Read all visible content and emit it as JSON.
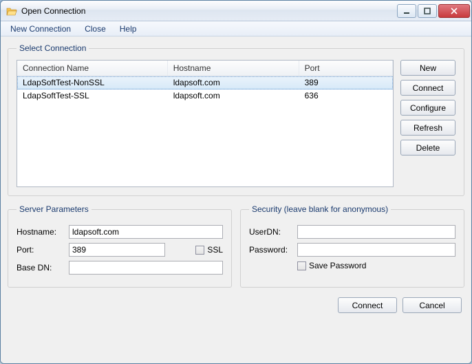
{
  "window": {
    "title": "Open Connection"
  },
  "menu": {
    "new_connection": "New Connection",
    "close": "Close",
    "help": "Help"
  },
  "select": {
    "legend": "Select Connection",
    "columns": {
      "name": "Connection Name",
      "host": "Hostname",
      "port": "Port"
    },
    "rows": [
      {
        "name": "LdapSoftTest-NonSSL",
        "host": "ldapsoft.com",
        "port": "389",
        "selected": true
      },
      {
        "name": "LdapSoftTest-SSL",
        "host": "ldapsoft.com",
        "port": "636",
        "selected": false
      }
    ],
    "buttons": {
      "new": "New",
      "connect": "Connect",
      "configure": "Configure",
      "refresh": "Refresh",
      "delete": "Delete"
    }
  },
  "server": {
    "legend": "Server Parameters",
    "labels": {
      "hostname": "Hostname:",
      "port": "Port:",
      "basedn": "Base DN:",
      "ssl": "SSL"
    },
    "values": {
      "hostname": "ldapsoft.com",
      "port": "389",
      "basedn": ""
    },
    "ssl_checked": false
  },
  "security": {
    "legend": "Security (leave blank for anonymous)",
    "labels": {
      "userdn": "UserDN:",
      "password": "Password:",
      "save": "Save Password"
    },
    "values": {
      "userdn": "",
      "password": ""
    },
    "save_password_checked": false
  },
  "footer": {
    "connect": "Connect",
    "cancel": "Cancel"
  }
}
